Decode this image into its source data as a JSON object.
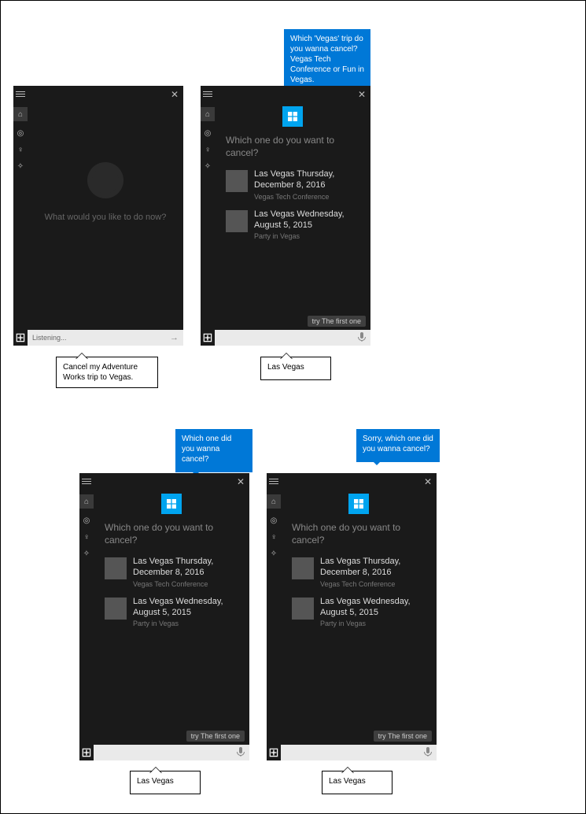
{
  "bubbles": {
    "top2": "Which 'Vegas' trip do you wanna cancel? Vegas Tech Conference or Fun in Vegas.",
    "top3": "Which one did you wanna cancel?",
    "top4": "Sorry, which one did you wanna cancel?"
  },
  "callouts": {
    "c1": "Cancel my Adventure Works trip to Vegas.",
    "c2": "Las Vegas",
    "c3": "Las Vegas",
    "c4": "Las Vegas"
  },
  "idle": {
    "prompt": "What would you like to do now?",
    "search_placeholder": "Listening...",
    "submit_glyph": "→"
  },
  "disamb": {
    "prompt": "Which one do you want to cancel?",
    "option1_title": "Las Vegas Thursday, December 8, 2016",
    "option1_sub": "Vegas Tech Conference",
    "option2_title": "Las Vegas Wednesday, August 5, 2015",
    "option2_sub": "Party in Vegas",
    "hint": "try The first one"
  },
  "glyphs": {
    "mic": "🎤",
    "close": "✕",
    "home": "⌂",
    "cam": "◎",
    "bulb": "♀",
    "chat": "✧",
    "win": "⊞"
  }
}
